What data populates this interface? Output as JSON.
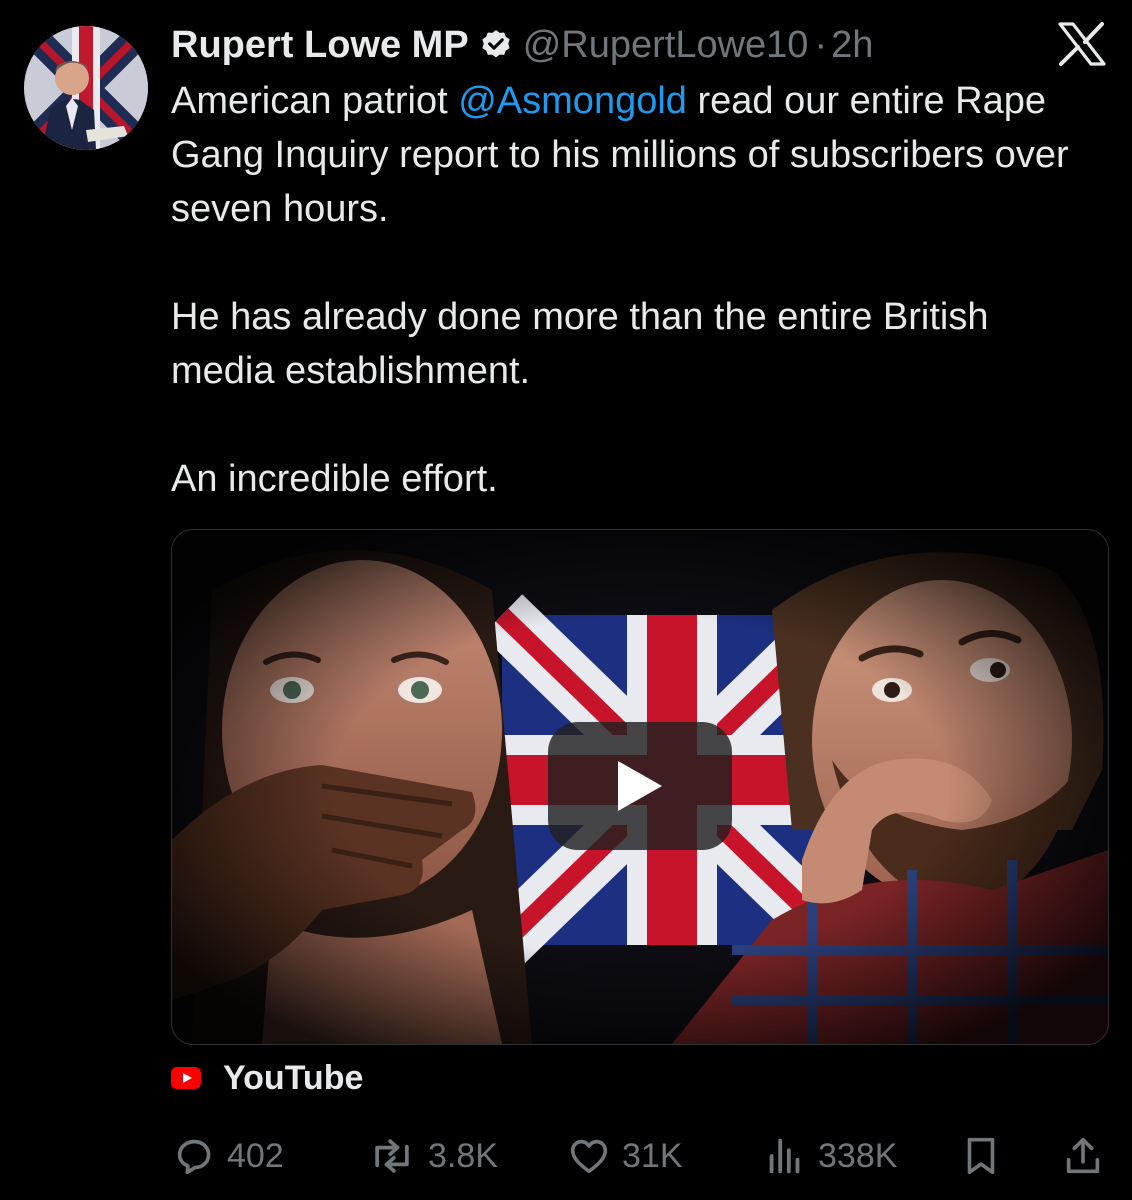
{
  "author": {
    "name": "Rupert Lowe MP",
    "handle": "@RupertLowe10",
    "separator": "·",
    "time": "2h",
    "verified_color": "#ffffff"
  },
  "tweet": {
    "line1_before": "American patriot ",
    "mention": "@Asmongold",
    "line1_after": " read our entire Rape Gang Inquiry report to his millions of subscribers over seven hours.",
    "paragraph2": "He has already done more than the entire British media establishment.",
    "paragraph3": "An incredible effort."
  },
  "link_card": {
    "source": "YouTube",
    "source_icon": "youtube-icon",
    "play_icon": "play-icon"
  },
  "actions": {
    "replies": "402",
    "reposts": "3.8K",
    "likes": "31K",
    "views": "338K"
  },
  "colors": {
    "background": "#000000",
    "text": "#e7e9ea",
    "muted": "#71767b",
    "link": "#1d9bf0",
    "youtube_red": "#ff0000"
  }
}
